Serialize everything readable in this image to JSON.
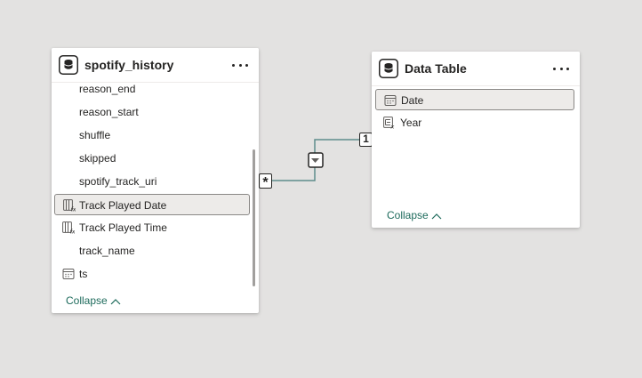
{
  "tables": {
    "spotify_history": {
      "title": "spotify_history",
      "fields": [
        {
          "label": "reason_end",
          "icon": "none"
        },
        {
          "label": "reason_start",
          "icon": "none"
        },
        {
          "label": "shuffle",
          "icon": "none"
        },
        {
          "label": "skipped",
          "icon": "none"
        },
        {
          "label": "spotify_track_uri",
          "icon": "none"
        },
        {
          "label": "Track Played Date",
          "icon": "calculated-column-icon",
          "selected": true
        },
        {
          "label": "Track Played Time",
          "icon": "calculated-column-icon"
        },
        {
          "label": "track_name",
          "icon": "none"
        },
        {
          "label": "ts",
          "icon": "calendar-icon"
        }
      ],
      "collapse_label": "Collapse"
    },
    "data_table": {
      "title": "Data Table",
      "fields": [
        {
          "label": "Date",
          "icon": "calendar-icon",
          "selected": true
        },
        {
          "label": "Year",
          "icon": "hierarchy-icon"
        }
      ],
      "collapse_label": "Collapse"
    }
  },
  "relationship": {
    "many_side": "*",
    "one_side": "1",
    "direction": "single"
  },
  "colors": {
    "canvas": "#e3e2e1",
    "link": "#1e6b5c",
    "relationship_line": "#5e8c8c",
    "selected_row": "#edebe9"
  }
}
